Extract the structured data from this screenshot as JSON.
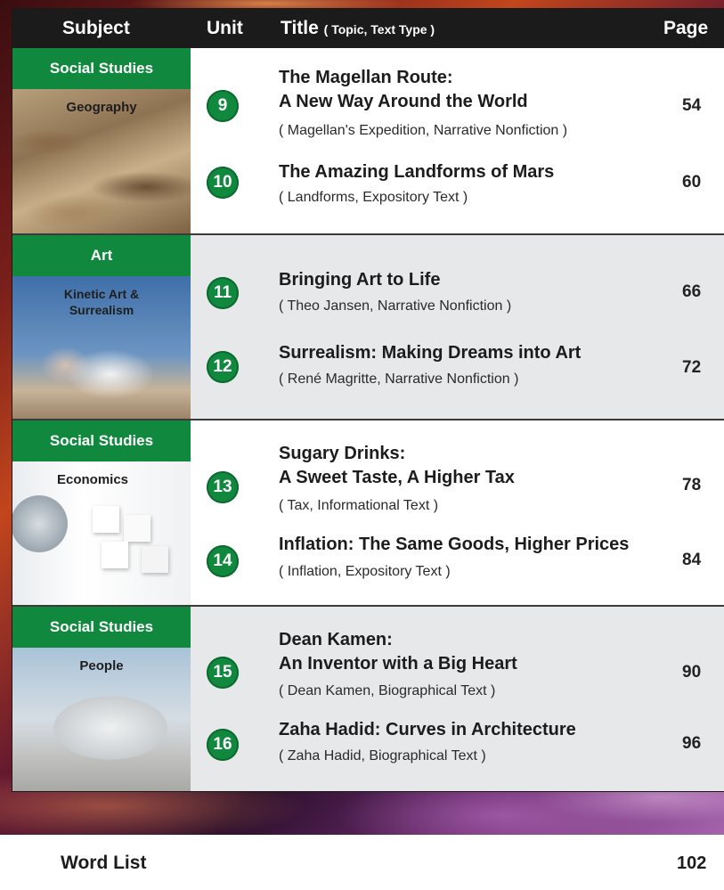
{
  "header": {
    "subject": "Subject",
    "unit": "Unit",
    "title": "Title",
    "title_note": "( Topic, Text Type )",
    "page": "Page"
  },
  "sections": [
    {
      "subject": "Social Studies",
      "topic": "Geography",
      "entries": [
        {
          "unit": "9",
          "title_lines": [
            "The Magellan Route:",
            "A New Way Around the World"
          ],
          "subtitle": "( Magellan's Expedition, Narrative Nonfiction )",
          "page": "54"
        },
        {
          "unit": "10",
          "title_lines": [
            "The Amazing Landforms of Mars"
          ],
          "subtitle": "( Landforms, Expository Text )",
          "page": "60"
        }
      ]
    },
    {
      "subject": "Art",
      "topic_lines": [
        "Kinetic Art &",
        "Surrealism"
      ],
      "entries": [
        {
          "unit": "11",
          "title_lines": [
            "Bringing Art to Life"
          ],
          "subtitle": "( Theo Jansen, Narrative Nonfiction )",
          "page": "66"
        },
        {
          "unit": "12",
          "title_lines": [
            "Surrealism: Making Dreams into Art"
          ],
          "subtitle": "( René Magritte, Narrative Nonfiction )",
          "page": "72"
        }
      ]
    },
    {
      "subject": "Social Studies",
      "topic": "Economics",
      "entries": [
        {
          "unit": "13",
          "title_lines": [
            "Sugary Drinks:",
            "A Sweet Taste, A Higher Tax"
          ],
          "subtitle": "( Tax, Informational Text )",
          "page": "78"
        },
        {
          "unit": "14",
          "title_lines": [
            "Inflation: The Same Goods, Higher Prices"
          ],
          "subtitle": "( Inflation, Expository Text )",
          "page": "84"
        }
      ]
    },
    {
      "subject": "Social Studies",
      "topic": "People",
      "entries": [
        {
          "unit": "15",
          "title_lines": [
            "Dean Kamen:",
            "An Inventor with a Big Heart"
          ],
          "subtitle": "( Dean Kamen, Biographical Text )",
          "page": "90"
        },
        {
          "unit": "16",
          "title_lines": [
            "Zaha Hadid: Curves in Architecture"
          ],
          "subtitle": "( Zaha Hadid, Biographical Text )",
          "page": "96"
        }
      ]
    }
  ],
  "word_list": {
    "label": "Word List",
    "page": "102"
  },
  "colors": {
    "accent_green": "#10893e",
    "header_bg": "#1b1b1b",
    "gray_band": "#e6e8ea"
  }
}
